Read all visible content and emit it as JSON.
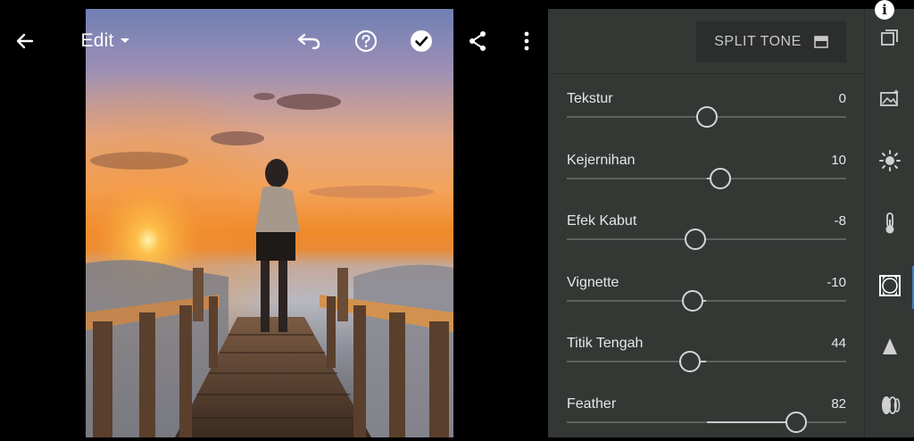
{
  "toolbar": {
    "edit_label": "Edit",
    "icons": [
      "back-arrow-icon",
      "dropdown-caret-icon",
      "undo-icon",
      "help-icon",
      "checkmark-icon",
      "share-icon",
      "more-vert-icon"
    ]
  },
  "panel": {
    "preset_button_label": "SPLIT TONE",
    "sliders": [
      {
        "label": "Tekstur",
        "value": "0",
        "level": 0.5
      },
      {
        "label": "Kejernihan",
        "value": "10",
        "level": 0.55
      },
      {
        "label": "Efek Kabut",
        "value": "-8",
        "level": 0.46
      },
      {
        "label": "Vignette",
        "value": "-10",
        "level": 0.45
      },
      {
        "label": "Titik Tengah",
        "value": "44",
        "level": 0.44
      },
      {
        "label": "Feather",
        "value": "82",
        "level": 0.82
      }
    ]
  },
  "rail": {
    "icons": [
      "presets-stack-icon",
      "auto-image-icon",
      "light-sun-icon",
      "color-temperature-icon",
      "vignette-effects-icon",
      "detail-triangle-icon",
      "optics-lens-icon"
    ],
    "active": "vignette-effects-icon"
  },
  "colors": {
    "accent": "#3c7fd0",
    "panel": "#343835",
    "background": "#000000"
  }
}
